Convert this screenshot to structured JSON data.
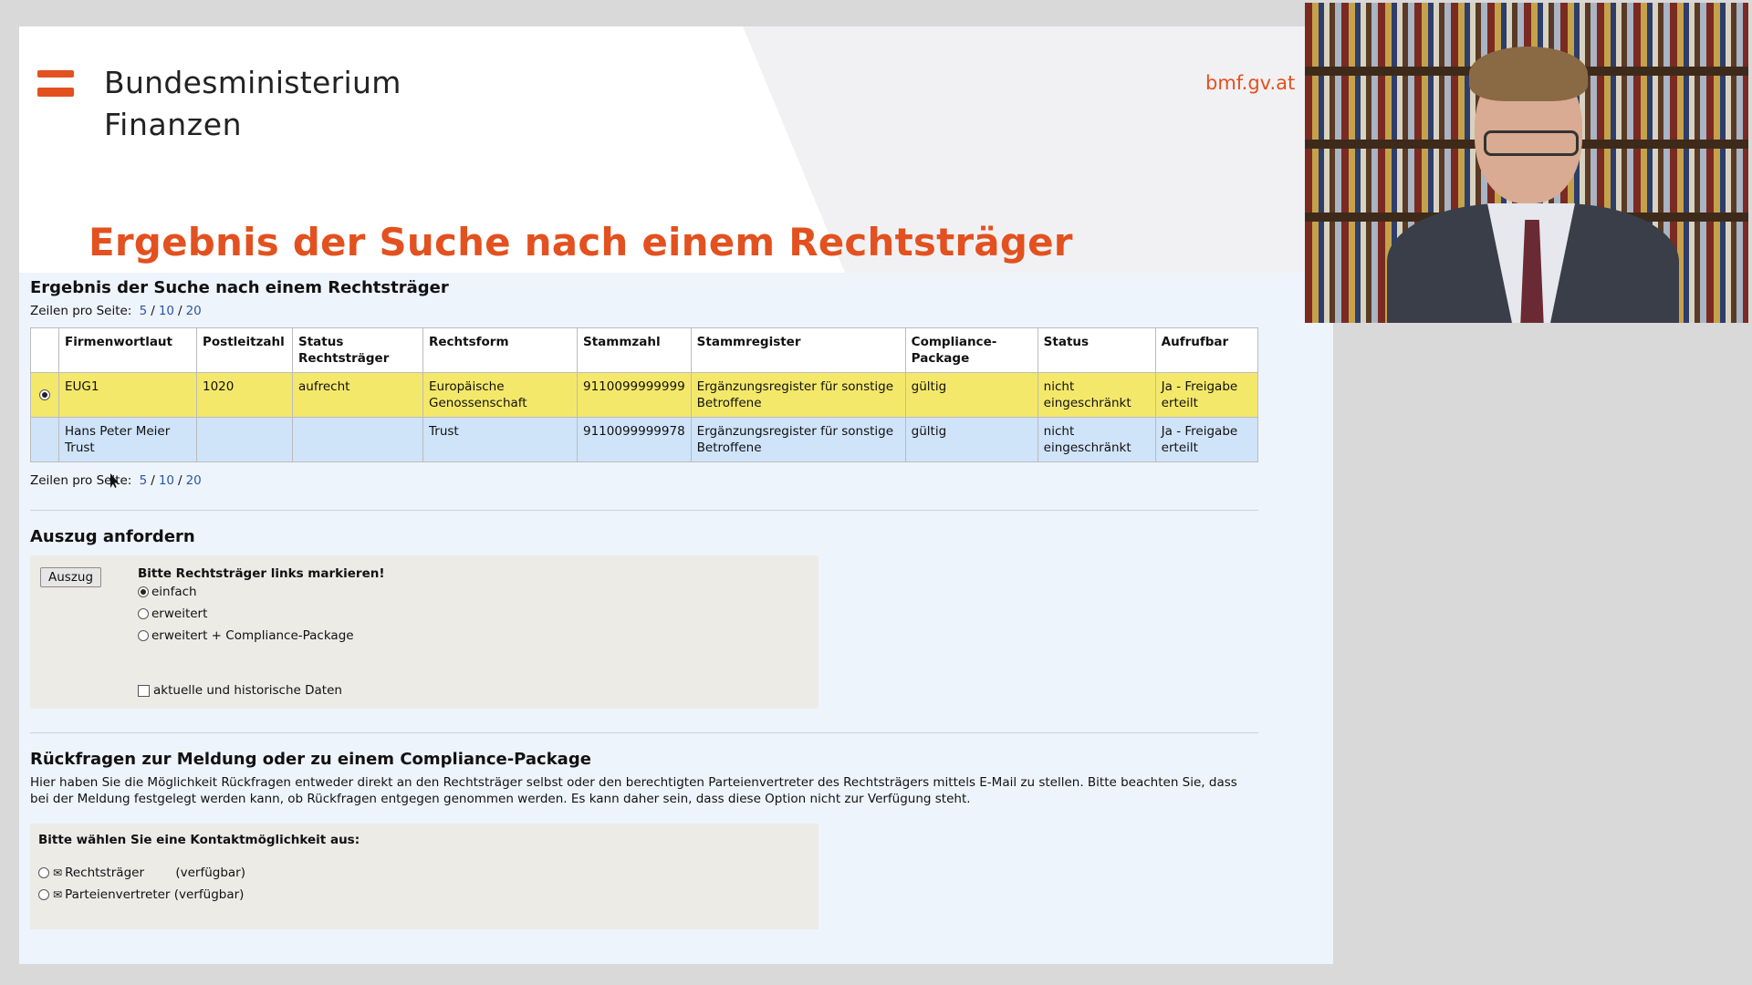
{
  "slide": {
    "logo_line1": "Bundesministerium",
    "logo_line2": "Finanzen",
    "site": "bmf.gv.at",
    "title": "Ergebnis der Suche nach einem Rechtsträger",
    "accent_color": "#e2511f"
  },
  "results": {
    "heading": "Ergebnis der Suche nach einem Rechtsträger",
    "pager_label": "Zeilen pro Seite:",
    "pager_options": [
      "5",
      "10",
      "20"
    ],
    "pager_sep": "/",
    "columns": [
      "Firmenwortlaut",
      "Postleitzahl",
      "Status Rechtsträger",
      "Rechtsform",
      "Stammzahl",
      "Stammregister",
      "Compliance-Package",
      "Status",
      "Aufrufbar"
    ],
    "rows": [
      {
        "selected": true,
        "firmenwortlaut": "EUG1",
        "postleitzahl": "1020",
        "status_rt": "aufrecht",
        "rechtsform": "Europäische Genossenschaft",
        "stammzahl": "9110099999999",
        "stammregister": "Ergänzungsregister für sonstige Betroffene",
        "compliance": "gültig",
        "status": "nicht eingeschränkt",
        "aufrufbar": "Ja - Freigabe erteilt"
      },
      {
        "selected": false,
        "firmenwortlaut": "Hans Peter Meier Trust",
        "postleitzahl": "",
        "status_rt": "",
        "rechtsform": "Trust",
        "stammzahl": "9110099999978",
        "stammregister": "Ergänzungsregister für sonstige Betroffene",
        "compliance": "gültig",
        "status": "nicht eingeschränkt",
        "aufrufbar": "Ja - Freigabe erteilt"
      }
    ]
  },
  "extract": {
    "heading": "Auszug anfordern",
    "button": "Auszug",
    "hint": "Bitte Rechtsträger links markieren!",
    "options": [
      "einfach",
      "erweitert",
      "erweitert + Compliance-Package"
    ],
    "selected_option": "einfach",
    "history_label": "aktuelle und historische Daten",
    "history_checked": false
  },
  "contact": {
    "heading": "Rückfragen zur Meldung oder zu einem Compliance-Package",
    "description": "Hier haben Sie die Möglichkeit Rückfragen entweder direkt an den Rechtsträger selbst oder den berechtigten Parteienvertreter des Rechtsträgers mittels E-Mail zu stellen. Bitte beachten Sie, dass bei der Meldung festgelegt werden kann, ob Rückfragen entgegen genommen werden. Es kann daher sein, dass diese Option nicht zur Verfügung steht.",
    "hint": "Bitte wählen Sie eine Kontaktmöglichkeit aus:",
    "options": [
      {
        "label": "Rechtsträger",
        "availability": "(verfügbar)"
      },
      {
        "label": "Parteienvertreter",
        "availability": "(verfügbar)"
      }
    ],
    "envelope_icon": "✉"
  }
}
